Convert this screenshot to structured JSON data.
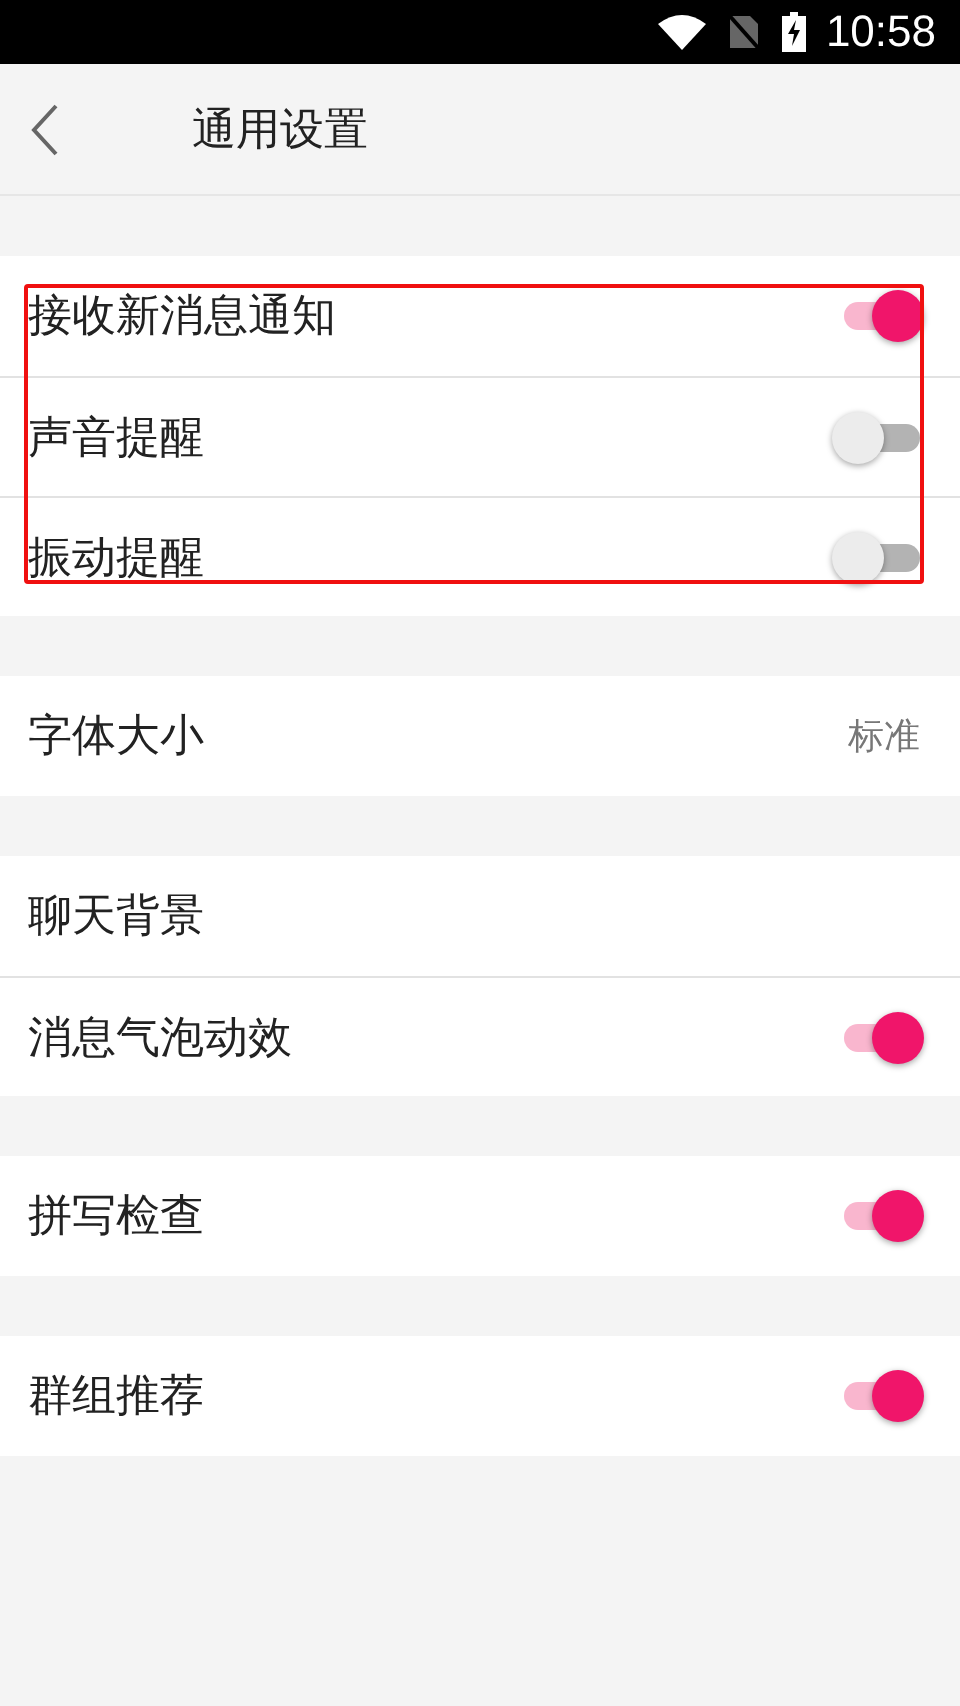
{
  "status_bar": {
    "time": "10:58"
  },
  "header": {
    "title": "通用设置"
  },
  "sections": [
    {
      "highlighted": true,
      "rows": [
        {
          "kind": "toggle",
          "label": "接收新消息通知",
          "on": true
        },
        {
          "kind": "toggle",
          "label": "声音提醒",
          "on": false
        },
        {
          "kind": "toggle",
          "label": "振动提醒",
          "on": false
        }
      ]
    },
    {
      "highlighted": false,
      "rows": [
        {
          "kind": "value",
          "label": "字体大小",
          "value": "标准"
        }
      ]
    },
    {
      "highlighted": false,
      "rows": [
        {
          "kind": "plain",
          "label": "聊天背景"
        },
        {
          "kind": "toggle",
          "label": "消息气泡动效",
          "on": true
        }
      ]
    },
    {
      "highlighted": false,
      "rows": [
        {
          "kind": "toggle",
          "label": "拼写检查",
          "on": true
        }
      ]
    },
    {
      "highlighted": false,
      "rows": [
        {
          "kind": "toggle",
          "label": "群组推荐",
          "on": true
        }
      ]
    }
  ]
}
